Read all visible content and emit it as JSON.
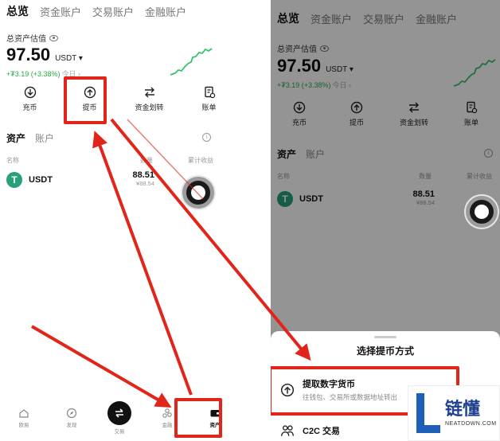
{
  "top_tabs": [
    "总览",
    "资金账户",
    "交易账户",
    "金融账户"
  ],
  "estimate_label": "总资产估值",
  "balance": {
    "value": "97.50",
    "unit": "USDT",
    "change": "+₮3.19 (+3.38%)",
    "today": "今日 ›"
  },
  "actions": [
    {
      "label": "充币",
      "icon": "deposit-icon"
    },
    {
      "label": "提币",
      "icon": "withdraw-icon"
    },
    {
      "label": "资金划转",
      "icon": "transfer-icon"
    },
    {
      "label": "账单",
      "icon": "bill-icon"
    }
  ],
  "section_tabs": {
    "active": "资产",
    "other": "账户"
  },
  "columns": {
    "name": "名称",
    "qty": "数量",
    "pnl": "累计收益"
  },
  "coin": {
    "symbol": "USDT",
    "qty": "88.51",
    "cny": "¥88.54",
    "logo_glyph": "T"
  },
  "bottom_nav": [
    {
      "label": "欧易",
      "icon": "home-icon"
    },
    {
      "label": "发现",
      "icon": "discover-icon"
    },
    {
      "label": "交易",
      "icon": "trade-icon"
    },
    {
      "label": "金融",
      "icon": "finance-icon"
    },
    {
      "label": "资产",
      "icon": "wallet-icon"
    }
  ],
  "sheet": {
    "title": "选择提币方式",
    "options": [
      {
        "title": "提取数字货币",
        "desc": "往钱包、交易所或数据地址转出"
      },
      {
        "title": "C2C 交易",
        "desc": ""
      }
    ]
  },
  "brand": {
    "cn": "链懂",
    "en": "NEATDOWN.COM"
  },
  "colors": {
    "highlight": "#e1251b",
    "positive": "#2aa84a",
    "usdt": "#26a17b"
  }
}
